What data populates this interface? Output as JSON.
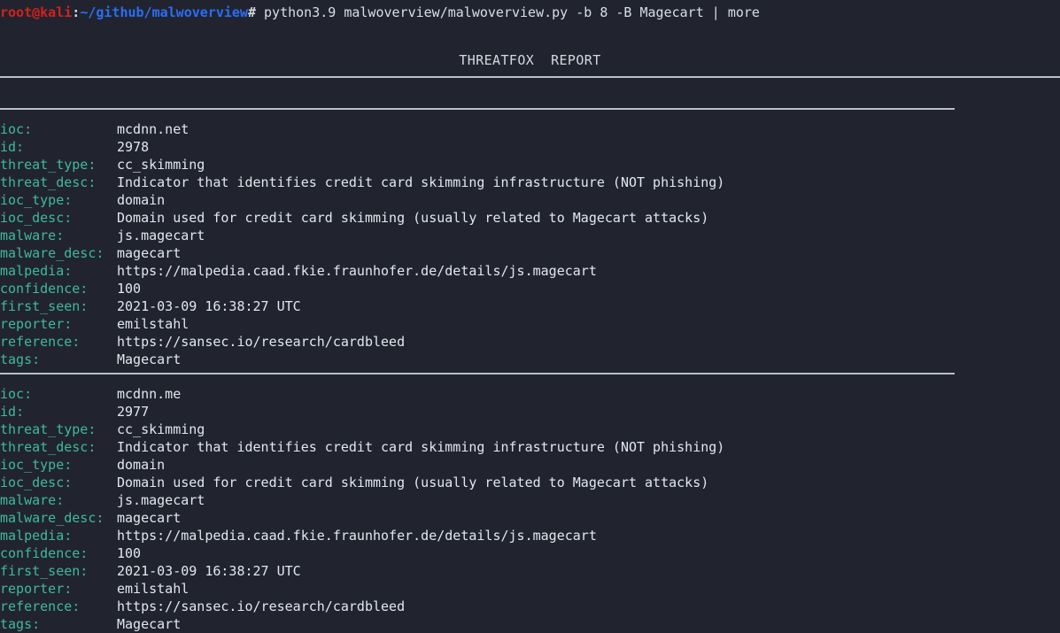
{
  "terminal": {
    "background_color": "#21242e",
    "prompt": {
      "user_host": "root@kali",
      "separator_colon": ":",
      "path": "~/github/malwoverview",
      "hash": "#",
      "command": " python3.9 malwoverview/malwoverview.py -b 8 -B Magecart | more",
      "user_host_color": "#d42020",
      "path_color": "#2a6ef5"
    },
    "report_title": "THREATFOX  REPORT",
    "label_color": "#3fb8a0",
    "value_color": "#e2e7ef",
    "separator_color": "#b9bfcb"
  },
  "records": [
    {
      "fields": [
        {
          "label": "ioc:",
          "value": "mcdnn.net"
        },
        {
          "label": "id:",
          "value": "2978"
        },
        {
          "label": "threat_type:",
          "value": "cc_skimming"
        },
        {
          "label": "threat_desc:",
          "value": "Indicator that identifies credit card skimming infrastructure (NOT phishing)"
        },
        {
          "label": "ioc_type:",
          "value": "domain"
        },
        {
          "label": "ioc_desc:",
          "value": "Domain used for credit card skimming (usually related to Magecart attacks)"
        },
        {
          "label": "malware:",
          "value": "js.magecart"
        },
        {
          "label": "malware_desc:",
          "value": "magecart"
        },
        {
          "label": "malpedia:",
          "value": "https://malpedia.caad.fkie.fraunhofer.de/details/js.magecart"
        },
        {
          "label": "confidence:",
          "value": "100"
        },
        {
          "label": "first_seen:",
          "value": "2021-03-09 16:38:27 UTC"
        },
        {
          "label": "reporter:",
          "value": "emilstahl"
        },
        {
          "label": "reference:",
          "value": "https://sansec.io/research/cardbleed"
        },
        {
          "label": "tags:",
          "value": "Magecart"
        }
      ]
    },
    {
      "fields": [
        {
          "label": "ioc:",
          "value": "mcdnn.me"
        },
        {
          "label": "id:",
          "value": "2977"
        },
        {
          "label": "threat_type:",
          "value": "cc_skimming"
        },
        {
          "label": "threat_desc:",
          "value": "Indicator that identifies credit card skimming infrastructure (NOT phishing)"
        },
        {
          "label": "ioc_type:",
          "value": "domain"
        },
        {
          "label": "ioc_desc:",
          "value": "Domain used for credit card skimming (usually related to Magecart attacks)"
        },
        {
          "label": "malware:",
          "value": "js.magecart"
        },
        {
          "label": "malware_desc:",
          "value": "magecart"
        },
        {
          "label": "malpedia:",
          "value": "https://malpedia.caad.fkie.fraunhofer.de/details/js.magecart"
        },
        {
          "label": "confidence:",
          "value": "100"
        },
        {
          "label": "first_seen:",
          "value": "2021-03-09 16:38:27 UTC"
        },
        {
          "label": "reporter:",
          "value": "emilstahl"
        },
        {
          "label": "reference:",
          "value": "https://sansec.io/research/cardbleed"
        },
        {
          "label": "tags:",
          "value": "Magecart"
        }
      ]
    }
  ]
}
